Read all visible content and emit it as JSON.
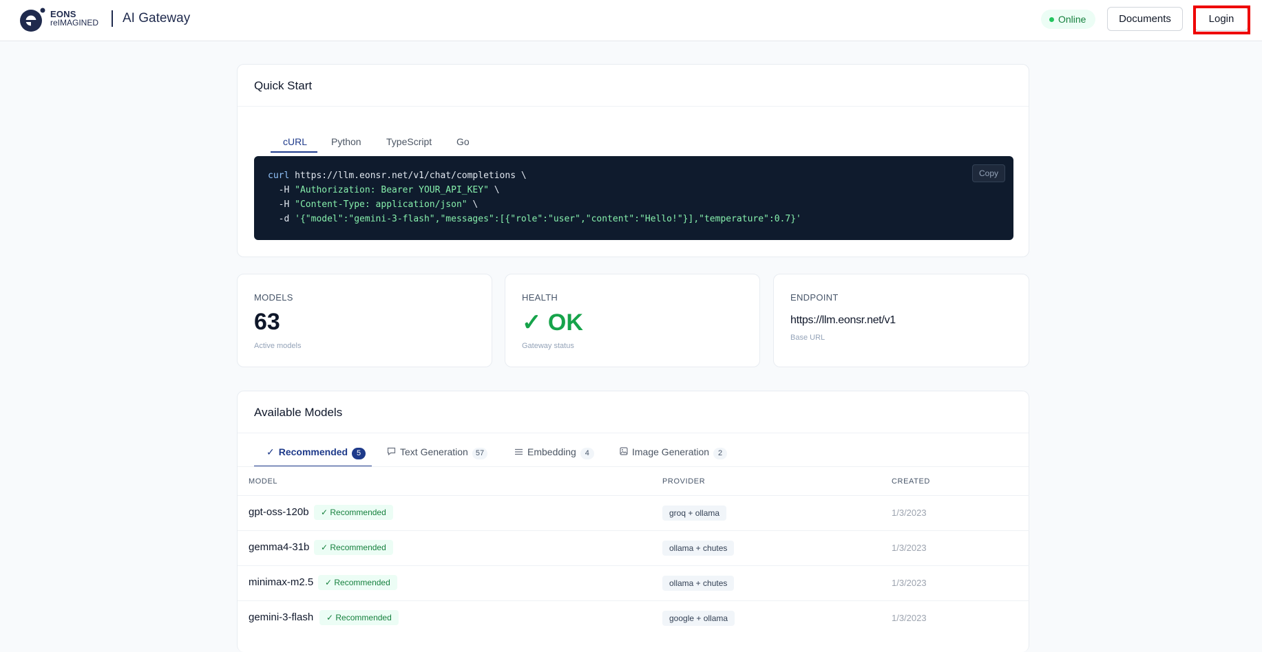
{
  "header": {
    "brand_line1": "EONS",
    "brand_line2": "reIMAGINED",
    "app_title": "AI Gateway",
    "status": "Online",
    "documents_label": "Documents",
    "login_label": "Login",
    "colors": {
      "brand": "#1f2a4d",
      "status_green": "#22c55e",
      "highlight": "#ee0000"
    }
  },
  "quickstart": {
    "title": "Quick Start",
    "tabs": [
      {
        "label": "cURL",
        "active": true
      },
      {
        "label": "Python",
        "active": false
      },
      {
        "label": "TypeScript",
        "active": false
      },
      {
        "label": "Go",
        "active": false
      }
    ],
    "code": {
      "line1_cmd": "curl",
      "line1_rest": " https://llm.eonsr.net/v1/chat/completions \\",
      "line2_flag": "  -H ",
      "line2_str": "\"Authorization: Bearer YOUR_API_KEY\"",
      "line2_end": " \\",
      "line3_flag": "  -H ",
      "line3_str": "\"Content-Type: application/json\"",
      "line3_end": " \\",
      "line4_flag": "  -d ",
      "line4_str": "'{\"model\":\"gemini-3-flash\",\"messages\":[{\"role\":\"user\",\"content\":\"Hello!\"}],\"temperature\":0.7}'"
    },
    "copy_label": "Copy"
  },
  "stats": {
    "models": {
      "label": "MODELS",
      "value": "63",
      "sub": "Active models"
    },
    "health": {
      "label": "HEALTH",
      "value": "✓ OK",
      "sub": "Gateway status"
    },
    "endpoint": {
      "label": "ENDPOINT",
      "value": "https://llm.eonsr.net/v1",
      "sub": "Base URL"
    }
  },
  "models": {
    "title": "Available Models",
    "tabs": [
      {
        "icon": "check-icon",
        "label": "Recommended",
        "count": "5",
        "active": true
      },
      {
        "icon": "chat-icon",
        "label": "Text Generation",
        "count": "57",
        "active": false
      },
      {
        "icon": "list-icon",
        "label": "Embedding",
        "count": "4",
        "active": false
      },
      {
        "icon": "image-icon",
        "label": "Image Generation",
        "count": "2",
        "active": false
      }
    ],
    "columns": {
      "model": "MODEL",
      "provider": "PROVIDER",
      "created": "CREATED"
    },
    "badge_label": "✓ Recommended",
    "rows": [
      {
        "name": "gpt-oss-120b",
        "provider": "groq + ollama",
        "created": "1/3/2023"
      },
      {
        "name": "gemma4-31b",
        "provider": "ollama + chutes",
        "created": "1/3/2023"
      },
      {
        "name": "minimax-m2.5",
        "provider": "ollama + chutes",
        "created": "1/3/2023"
      },
      {
        "name": "gemini-3-flash",
        "provider": "google + ollama",
        "created": "1/3/2023"
      }
    ]
  }
}
